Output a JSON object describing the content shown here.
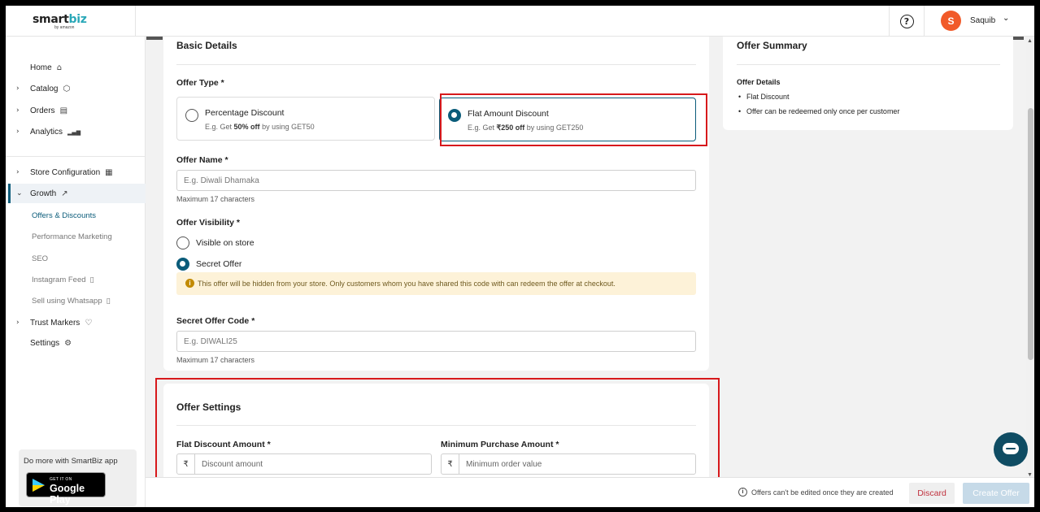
{
  "header": {
    "logo_main": "smart",
    "logo_accent": "biz",
    "logo_sub": "by amazon",
    "help_symbol": "?",
    "avatar_initial": "S",
    "user_name": "Saquib",
    "user_chevron": "⌄"
  },
  "sidebar": {
    "items": [
      {
        "label": "Home",
        "icon": "home-icon",
        "glyph": "⌂",
        "chevron": ""
      },
      {
        "label": "Catalog",
        "icon": "cube-icon",
        "glyph": "⬡",
        "chevron": "›"
      },
      {
        "label": "Orders",
        "icon": "clipboard-icon",
        "glyph": "▤",
        "chevron": "›"
      },
      {
        "label": "Analytics",
        "icon": "bar-chart-icon",
        "glyph": "▂▄▆",
        "chevron": "›"
      },
      {
        "label": "Store Configuration",
        "icon": "store-icon",
        "glyph": "▦",
        "chevron": "›"
      },
      {
        "label": "Growth",
        "icon": "trend-up-icon",
        "glyph": "↗",
        "chevron": "⌄"
      },
      {
        "label": "Trust Markers",
        "icon": "heart-shield-icon",
        "glyph": "♡",
        "chevron": "›"
      },
      {
        "label": "Settings",
        "icon": "gear-icon",
        "glyph": "⚙",
        "chevron": ""
      }
    ],
    "growth_sub": [
      {
        "label": "Offers & Discounts",
        "glyph": ""
      },
      {
        "label": "Performance Marketing",
        "glyph": ""
      },
      {
        "label": "SEO",
        "glyph": ""
      },
      {
        "label": "Instagram Feed",
        "glyph": "▯"
      },
      {
        "label": "Sell using Whatsapp",
        "glyph": "▯"
      }
    ],
    "app_promo": "Do more with SmartBiz app",
    "gplay_small": "GET IT ON",
    "gplay_big": "Google Play"
  },
  "basic": {
    "title": "Basic Details",
    "offer_type_label": "Offer Type *",
    "options": [
      {
        "title": "Percentage Discount",
        "sub_prefix": "E.g. Get",
        "sub_bold": "50% off",
        "sub_suffix": "by using GET50",
        "selected": false
      },
      {
        "title": "Flat Amount Discount",
        "sub_prefix": "E.g. Get",
        "sub_bold": "₹250 off",
        "sub_suffix": "by using GET250",
        "selected": true
      }
    ],
    "offer_name_label": "Offer Name *",
    "offer_name_placeholder": "E.g. Diwali Dhamaka",
    "offer_name_helper": "Maximum 17 characters",
    "visibility_label": "Offer Visibility *",
    "visibility_options": [
      {
        "label": "Visible on store",
        "selected": false
      },
      {
        "label": "Secret Offer",
        "selected": true
      }
    ],
    "notice_icon": "i",
    "notice": "This offer will be hidden from your store. Only customers whom you have shared this code with can redeem the offer at checkout.",
    "secret_code_label": "Secret Offer Code *",
    "secret_code_placeholder": "E.g. DIWALI25",
    "secret_code_helper": "Maximum 17 characters"
  },
  "settings": {
    "title": "Offer Settings",
    "flat_label": "Flat Discount Amount *",
    "flat_placeholder": "Discount amount",
    "min_label": "Minimum Purchase Amount *",
    "min_placeholder": "Minimum order value",
    "currency": "₹"
  },
  "summary": {
    "title": "Offer Summary",
    "details_label": "Offer Details",
    "bullets": [
      "Flat Discount",
      "Offer can be redeemed only once per customer"
    ]
  },
  "footer": {
    "info_icon": "i",
    "note": "Offers can't be edited once they are created",
    "discard": "Discard",
    "create": "Create Offer"
  },
  "scrollbar": {
    "up": "▲",
    "down": "▼"
  },
  "colors": {
    "accent": "#0b5c7a",
    "highlight": "#d7191c",
    "avatar": "#f15a29",
    "notice_bg": "#fdf2d8",
    "create_disabled": "#c6dae8"
  }
}
